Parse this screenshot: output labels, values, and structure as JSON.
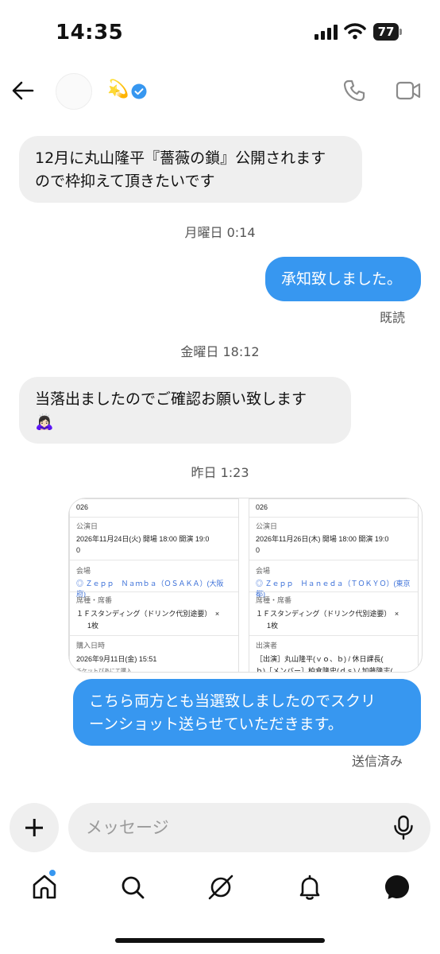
{
  "status_bar": {
    "time": "14:35",
    "battery": "77"
  },
  "header": {
    "contact_emoji": "💫"
  },
  "messages": {
    "m1_line1": "12月に丸山隆平『薔薇の鎖』公開されます",
    "m1_line2": "ので枠抑えて頂きたいです",
    "ts1": "月曜日 0:14",
    "m2": "承知致しました。",
    "read": "既読",
    "ts2": "金曜日 18:12",
    "m3_line1": "当落出ましたのでご確認お願い致します",
    "m3_emoji": "🙇🏻‍♀️",
    "ts3": "昨日 1:23",
    "m4_line1": "こちら両方とも当選致しましたのでスクリ",
    "m4_line2": "ーンショット送らせていただきます。",
    "sent": "送信済み"
  },
  "attachment": {
    "left": {
      "year_tail": "026",
      "date_label": "公演日",
      "date_line1": "2026年11月24日(火) 開場 18:00 開演 19:0",
      "date_line2": "0",
      "venue_label": "会場",
      "venue": "◎ Ｚｅｐｐ　Ｎａｍｂａ（ＯＳＡＫＡ）(大阪府)",
      "seat_label": "席種・席番",
      "seat_line1": "１Ｆスタンディング（ドリンク代別途要）　×",
      "seat_line2": "1枚",
      "purchase_label": "購入日時",
      "purchase": "2026年9月11日(金) 15:51",
      "note": "チケットぴあにて購入"
    },
    "right": {
      "year_tail": "026",
      "date_label": "公演日",
      "date_line1": "2026年11月26日(木) 開場 18:00 開演 19:0",
      "date_line2": "0",
      "venue_label": "会場",
      "venue": "◎ Ｚｅｐｐ　Ｈａｎｅｄａ（ＴＯＫＹＯ）(東京都)",
      "seat_label": "席種・席番",
      "seat_line1": "１Ｆスタンディング（ドリンク代別途要）　×",
      "seat_line2": "1枚",
      "cast_label": "出演者",
      "cast_line1": "［出演］丸山隆平(ｖｏ、ｂ) / 休日課長(",
      "cast_line2": "ｂ)［メンバー］柏倉隆史(ｄｓ) / 加藤隆志("
    }
  },
  "composer": {
    "placeholder": "メッセージ"
  },
  "colors": {
    "accent": "#3797f0",
    "incoming_bubble": "#efefef"
  }
}
